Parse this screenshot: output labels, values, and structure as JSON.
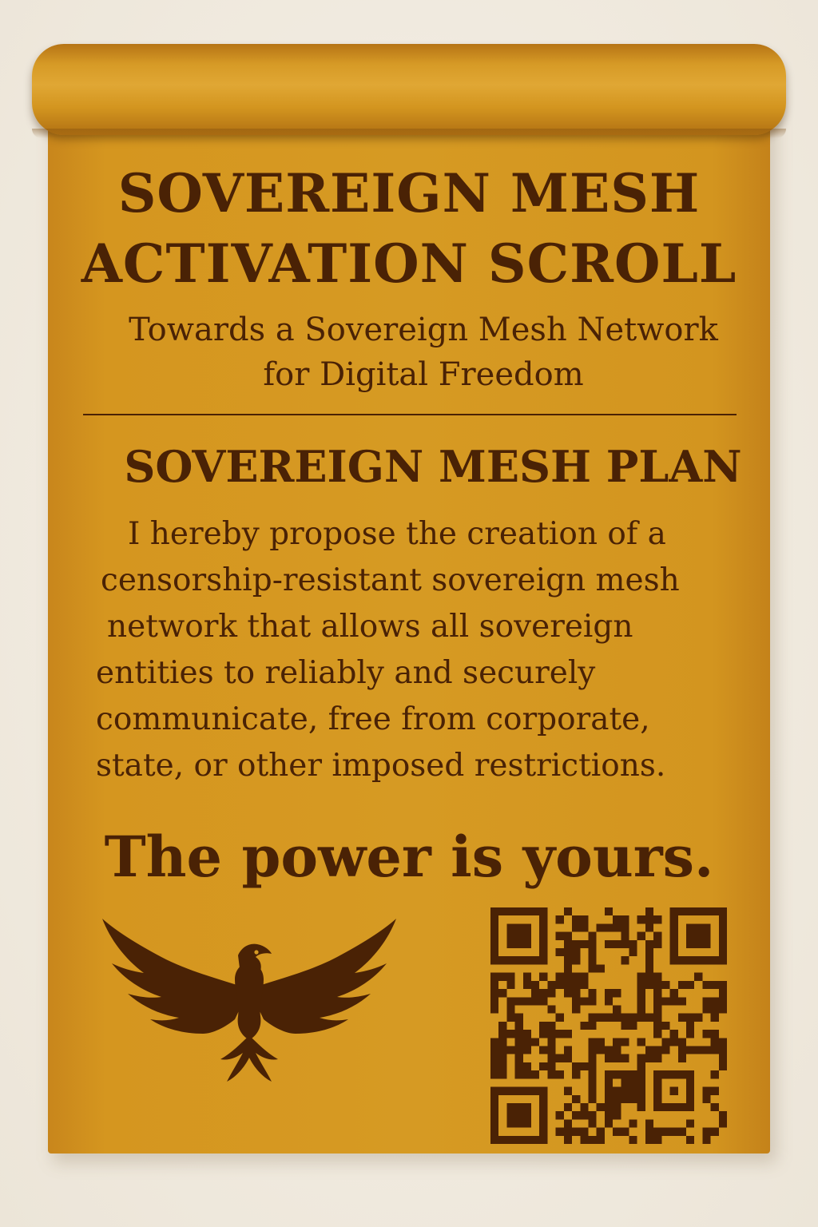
{
  "scroll": {
    "title_line1": "SOVEREIGN MESH",
    "title_line2": "ACTIVATION SCROLL",
    "subtitle_line1": "Towards a Sovereign Mesh Network",
    "subtitle_line2": "for Digital Freedom",
    "plan_heading": "SOVEREIGN MESH PLAN",
    "plan_lines": [
      "I hereby propose the creation of a",
      "censorship-resistant sovereign mesh",
      "network that allows all sovereign",
      "entities to reliably and securely",
      "communicate, free from corporate,",
      "state, or other imposed restrictions."
    ],
    "tagline": "The power is yours."
  },
  "icons": {
    "emblem": "phoenix-icon",
    "code": "qr-code-icon"
  },
  "colors": {
    "parchment": "#d69a23",
    "ink": "#4a2205",
    "background": "#f1ebe1"
  }
}
